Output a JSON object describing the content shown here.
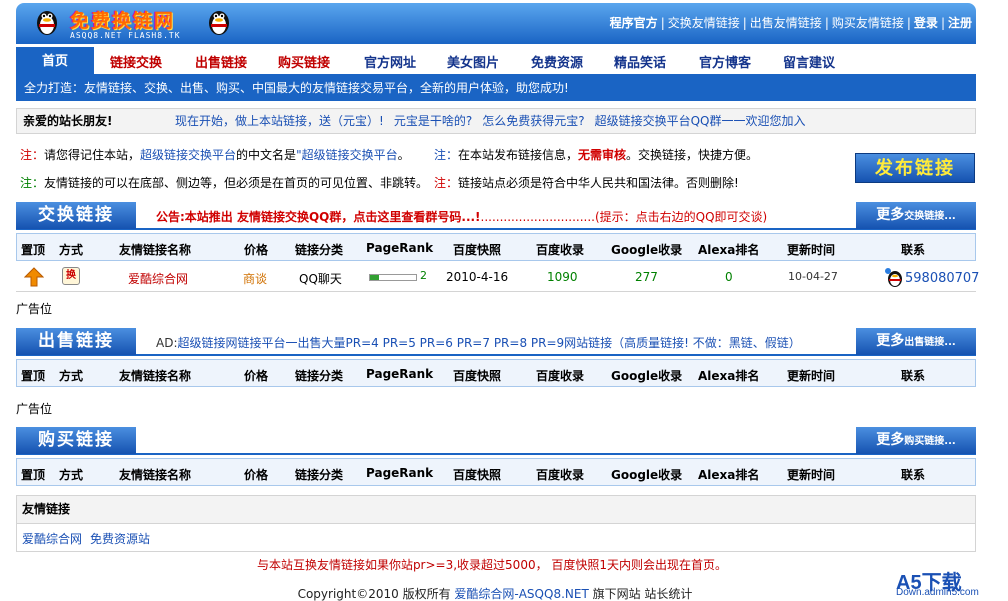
{
  "header": {
    "brand": "免费换链网",
    "domains": "ASQQ8.NET    FLASH8.TK",
    "topnav": [
      "程序官方",
      "交换友情链接",
      "出售友情链接",
      "购买友情链接",
      "登录",
      "注册"
    ]
  },
  "menu": {
    "items": [
      "首页",
      "链接交换",
      "出售链接",
      "购买链接",
      "官方网址",
      "美女图片",
      "免费资源",
      "精品笑话",
      "官方博客",
      "留言建议"
    ]
  },
  "slogan": "全力打造：友情链接、交换、出售、购买、中国最大的友情链接交易平台，全新的用户体验，助您成功!",
  "greeting": {
    "title": "亲爱的站长朋友!",
    "links": [
      "现在开始，做上本站链接，送（元宝）!",
      "元宝是干啥的?",
      "怎么免费获得元宝?",
      "超级链接交换平台QQ群一一欢迎您加入"
    ]
  },
  "notices": {
    "n1_label": "注：",
    "n1_a": "请您得记住本站，",
    "n1_b": "超级链接交换平台",
    "n1_c": "的中文名是",
    "n1_d": "\"超级链接交换平台",
    "n1_e": "。",
    "n2_label": "注：",
    "n2_a": "在本站发布链接信息，",
    "n2_b": "无需审核",
    "n2_c": "。交换链接，快捷方便。",
    "n3_label": "注：",
    "n3_a": "友情链接的可以在底部、侧边等，但必须是在首页的可见位置、非跳转。",
    "n4_label": "注：",
    "n4_a": "链接站点必须是符合中华人民共和国法律。否则删除!",
    "publish": "发布链接"
  },
  "exchange": {
    "title": "交换链接",
    "notice": "公告:本站推出 友情链接交换QQ群，点击这里查看群号码...!",
    "notice_tail": "..............................(提示：点击右边的QQ即可交谈)",
    "more": "更多",
    "more_small": "交换链接...",
    "rows": [
      {
        "swap_icon": "换",
        "name": "爱酷综合网",
        "price": "商谈",
        "category": "QQ聊天",
        "pagerank": "2",
        "pr_fraction": 0.2,
        "baidu_snapshot": "2010-4-16",
        "baidu_index": "1090",
        "google_index": "277",
        "alexa": "0",
        "updated": "10-04-27",
        "qq": "598080707"
      }
    ]
  },
  "columns": [
    "置顶",
    "方式",
    "友情链接名称",
    "价格",
    "链接分类",
    "PageRank",
    "百度快照",
    "百度收录",
    "Google收录",
    "Alexa排名",
    "更新时间",
    "联系"
  ],
  "ad_position": "广告位",
  "sell": {
    "title": "出售链接",
    "ad_label": "AD:",
    "ad_text": "超级链接网链接平台一出售大量PR=4 PR=5 PR=6 PR=7 PR=8 PR=9网站链接（高质量链接! 不做：黑链、假链）",
    "more": "更多",
    "more_small": "出售链接..."
  },
  "buy": {
    "title": "购买链接",
    "more": "更多",
    "more_small": "购买链接..."
  },
  "friend_links": {
    "title": "友情链接",
    "items": [
      "爱酷综合网",
      "免费资源站"
    ]
  },
  "footer": {
    "notice": "与本站互换友情链接如果你站pr>=3,收录超过5000， 百度快照1天内则会出现在首页。",
    "copyright_a": "Copyright©2010 版权所有 ",
    "copyright_link": "爱酷综合网-ASQQ8.NET",
    "copyright_b": " 旗下网站  站长统计"
  },
  "watermark": {
    "main": "A5下载",
    "sub": "Down.admin5.com"
  }
}
